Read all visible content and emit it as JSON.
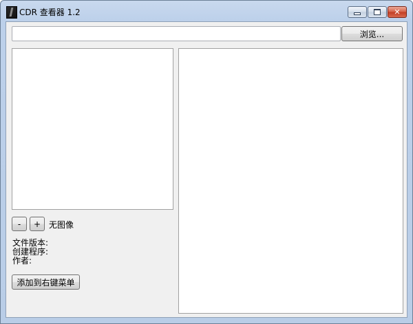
{
  "window": {
    "title": "CDR 查看器 1.2",
    "icon": "cdr-app-icon",
    "controls": {
      "minimize_icon": "minimize-icon",
      "maximize_icon": "maximize-icon",
      "close_icon": "close-icon",
      "close_glyph": "✕"
    }
  },
  "toolbar": {
    "path_value": "",
    "browse_label": "浏览..."
  },
  "thumbnail": {
    "zoom_out_label": "-",
    "zoom_in_label": "+",
    "status": "无图像"
  },
  "info": {
    "file_version": "文件版本:",
    "creator": "创建程序:",
    "author": "作者:"
  },
  "actions": {
    "add_context_menu_label": "添加到右键菜单"
  },
  "colors": {
    "frame": "#bcd0ea",
    "client": "#f0f0f0",
    "close": "#c13d23"
  }
}
